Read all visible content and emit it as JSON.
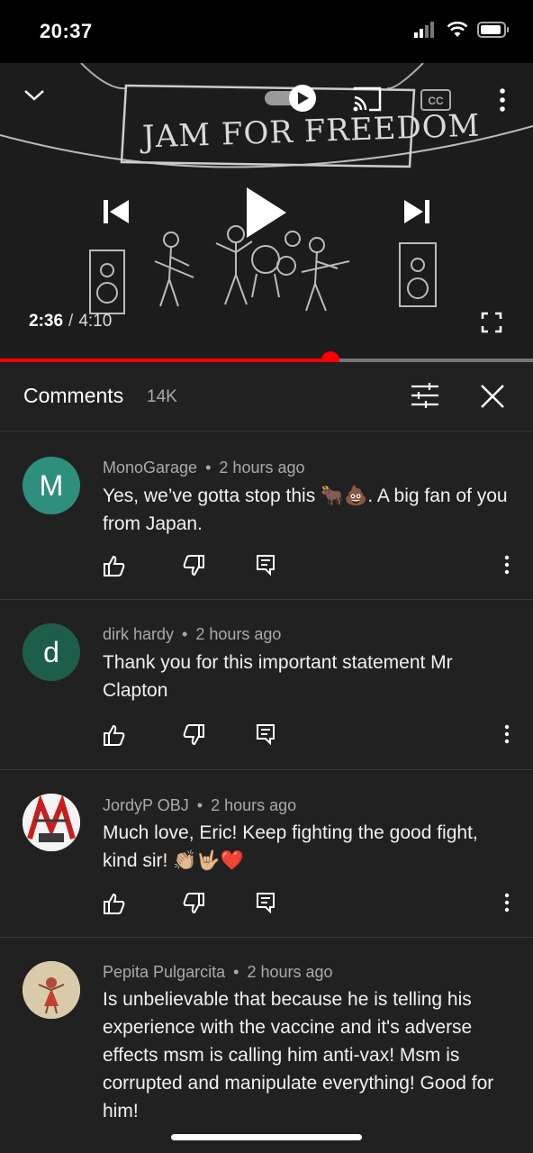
{
  "status_bar": {
    "time": "20:37"
  },
  "player": {
    "title_art_text": "JAM FOR FREEDOM",
    "current_time": "2:36",
    "duration": "4:10",
    "progress_fraction": 0.62,
    "accent_color": "#ff0000",
    "icons": [
      "chevron-down-icon",
      "autoplay-toggle-icon",
      "cast-icon",
      "captions-icon",
      "more-icon",
      "previous-icon",
      "play-icon",
      "next-icon",
      "fullscreen-icon"
    ]
  },
  "comments": {
    "title": "Comments",
    "count": "14K",
    "items": [
      {
        "author": "MonoGarage",
        "time": "2 hours ago",
        "avatar_letter": "M",
        "avatar_color": "#2f8f7f",
        "text": "Yes, we’ve gotta stop this 🐂💩. A big fan of you from Japan."
      },
      {
        "author": "dirk hardy",
        "time": "2 hours ago",
        "avatar_letter": "d",
        "avatar_color": "#1d5e4a",
        "text": "Thank you for this important statement Mr Clapton"
      },
      {
        "author": "JordyP OBJ",
        "time": "2 hours ago",
        "avatar_letter": "",
        "avatar_color": "#f2f2f2",
        "text": "Much love, Eric! Keep fighting the good fight, kind sir! 👏🏼🤟🏼❤️"
      },
      {
        "author": "Pepita Pulgarcita",
        "time": "2 hours ago",
        "avatar_letter": "",
        "avatar_color": "#d8c9a8",
        "text": "Is unbelievable that because he is telling his experience with the vaccine  and it's adverse effects msm is calling him anti-vax!  Msm is corrupted and manipulate everything! Good for him!"
      }
    ],
    "separator": "•"
  }
}
